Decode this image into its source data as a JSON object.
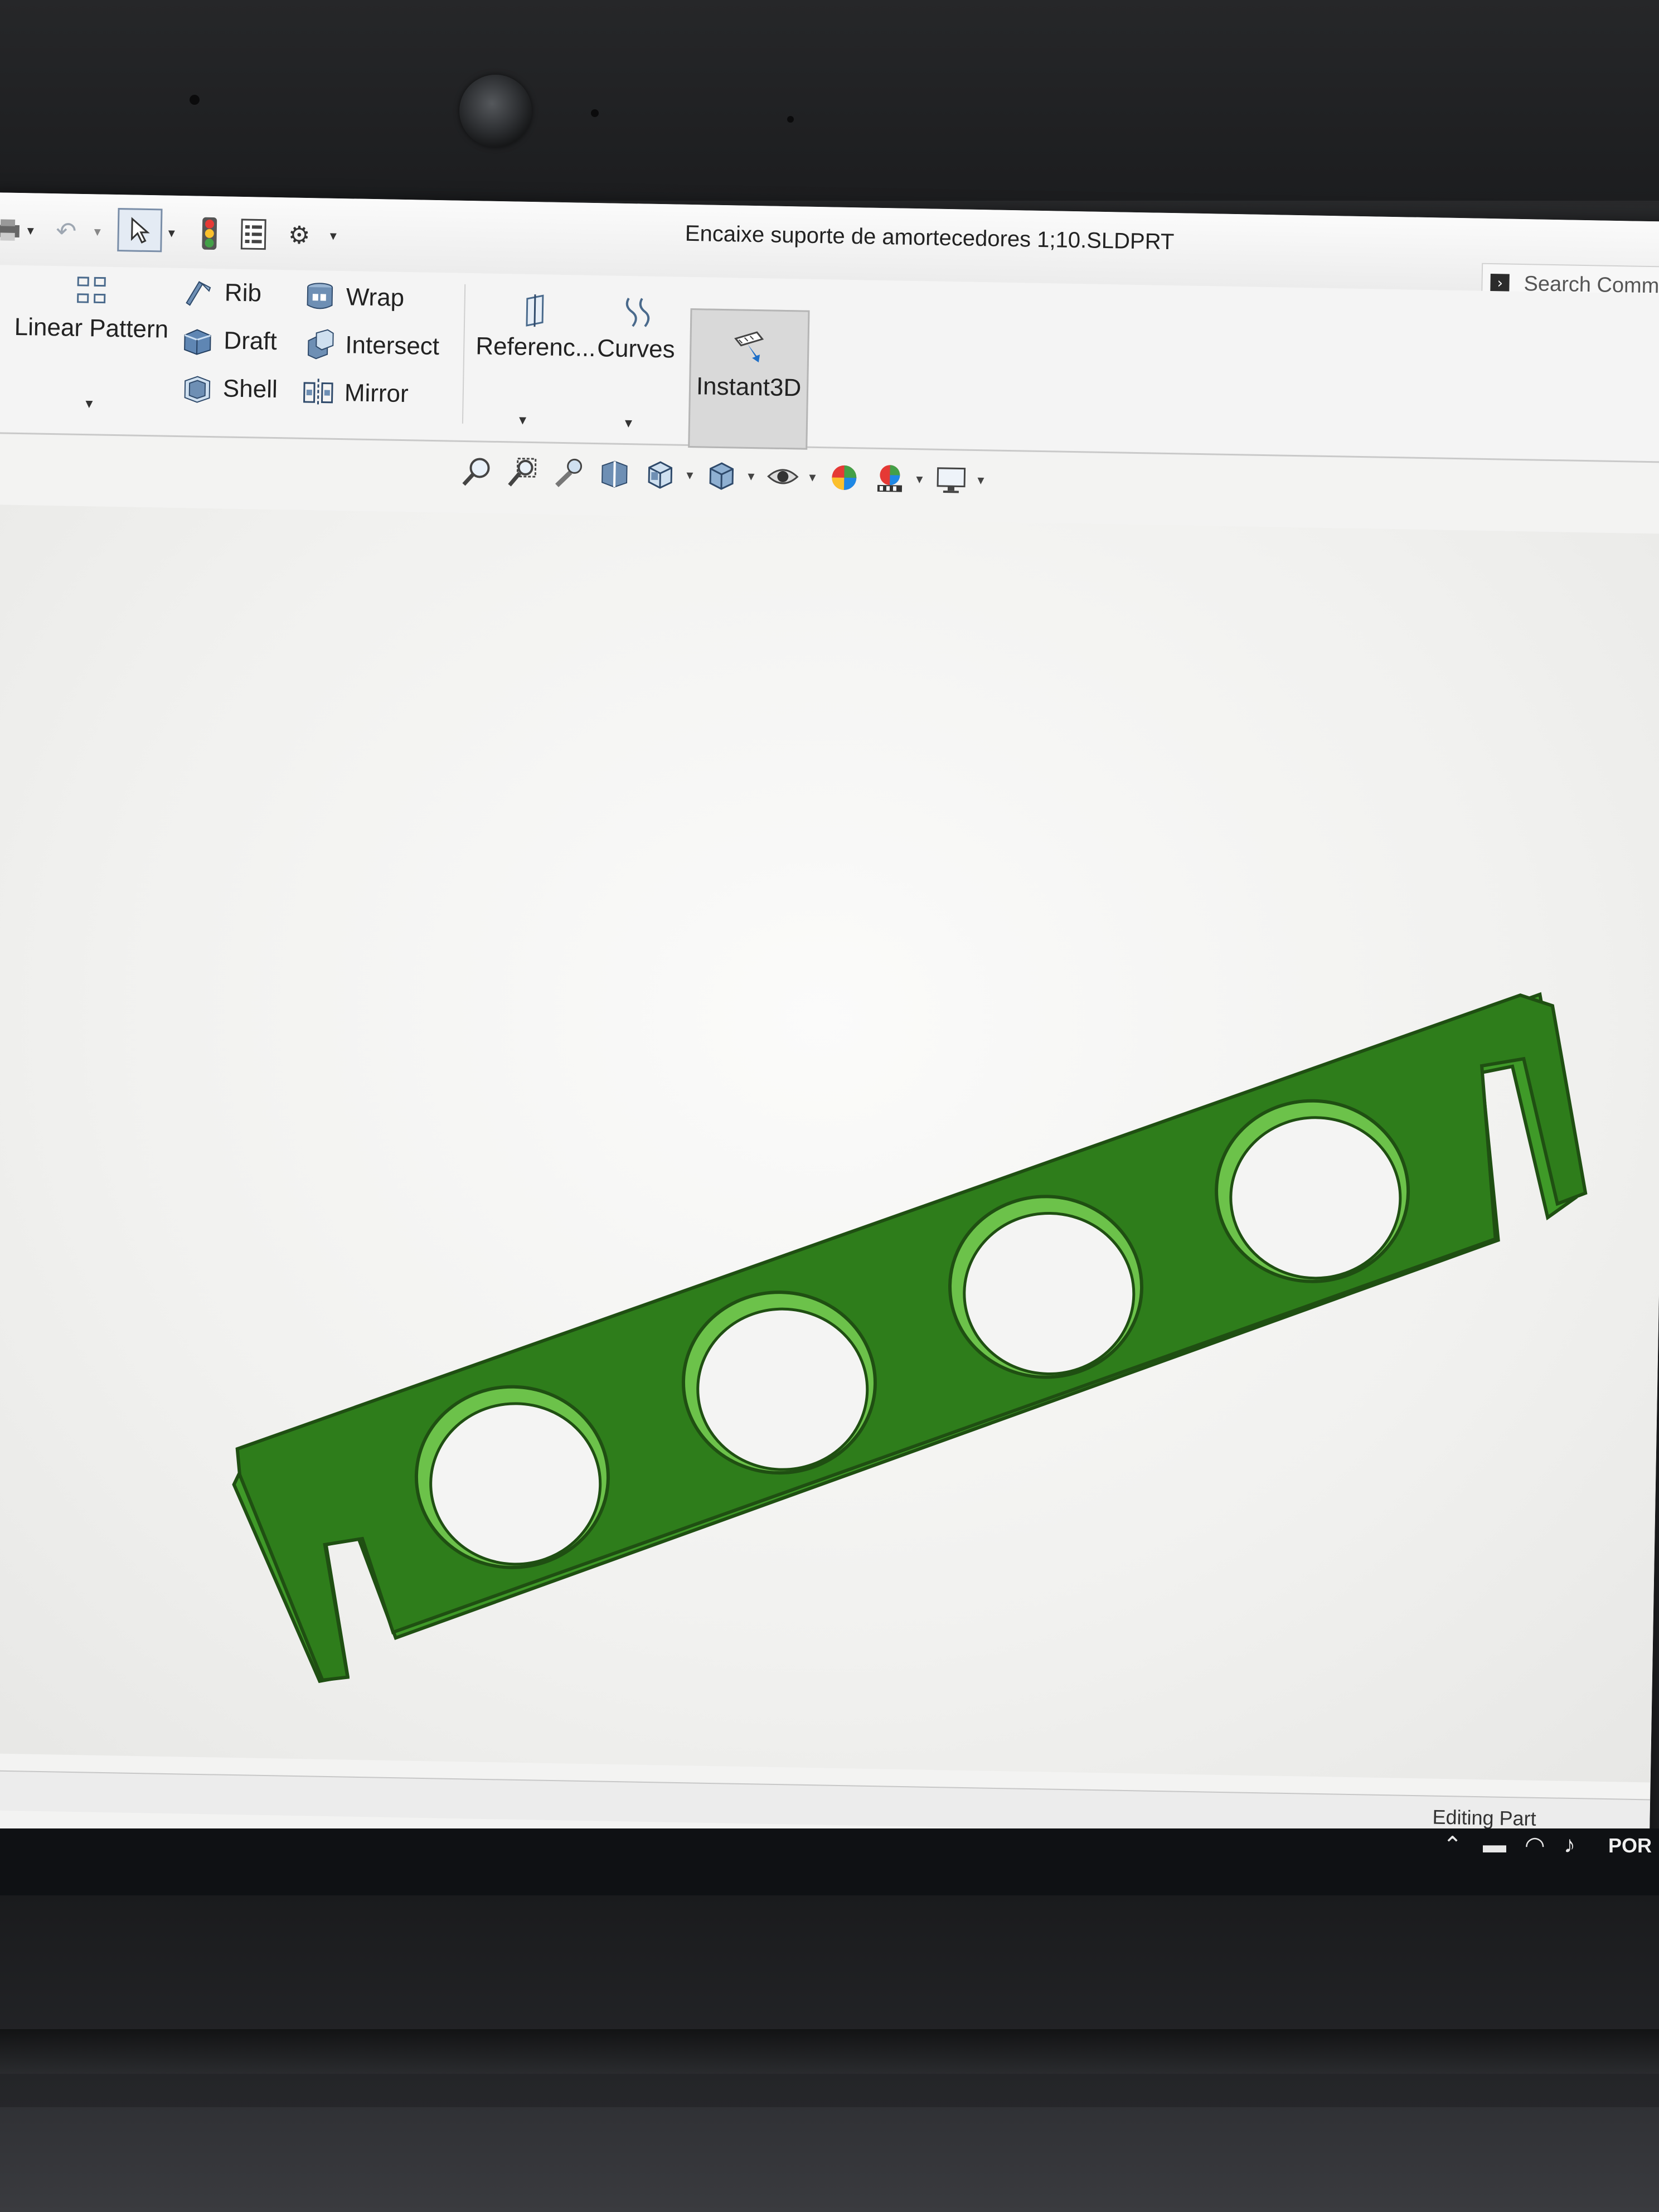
{
  "window": {
    "title": "Encaixe suporte de amortecedores 1;10.SLDPRT"
  },
  "search": {
    "placeholder": "Search Comm"
  },
  "ribbon": {
    "truncated_left": "t",
    "linear_pattern": "Linear Pattern",
    "rib": "Rib",
    "draft": "Draft",
    "shell": "Shell",
    "wrap": "Wrap",
    "intersect": "Intersect",
    "mirror": "Mirror",
    "reference": "Referenc...",
    "curves": "Curves",
    "instant3d": "Instant3D"
  },
  "status": {
    "text": "Editing Part"
  },
  "taskbar": {
    "language": "POR"
  },
  "colors": {
    "part_face": "#2e7d1b",
    "part_edge": "#1f4f12",
    "part_side": "#3f9a28",
    "hole_wall": "#6cc24a",
    "viewport_bg": "#f3f3f2"
  },
  "icons": {
    "print": "print-icon",
    "undo": "undo-icon",
    "select": "select-arrow-icon",
    "rebuild": "traffic-light-icon",
    "file_props": "file-properties-icon",
    "options": "gear-icon",
    "search": "command-search-icon"
  }
}
